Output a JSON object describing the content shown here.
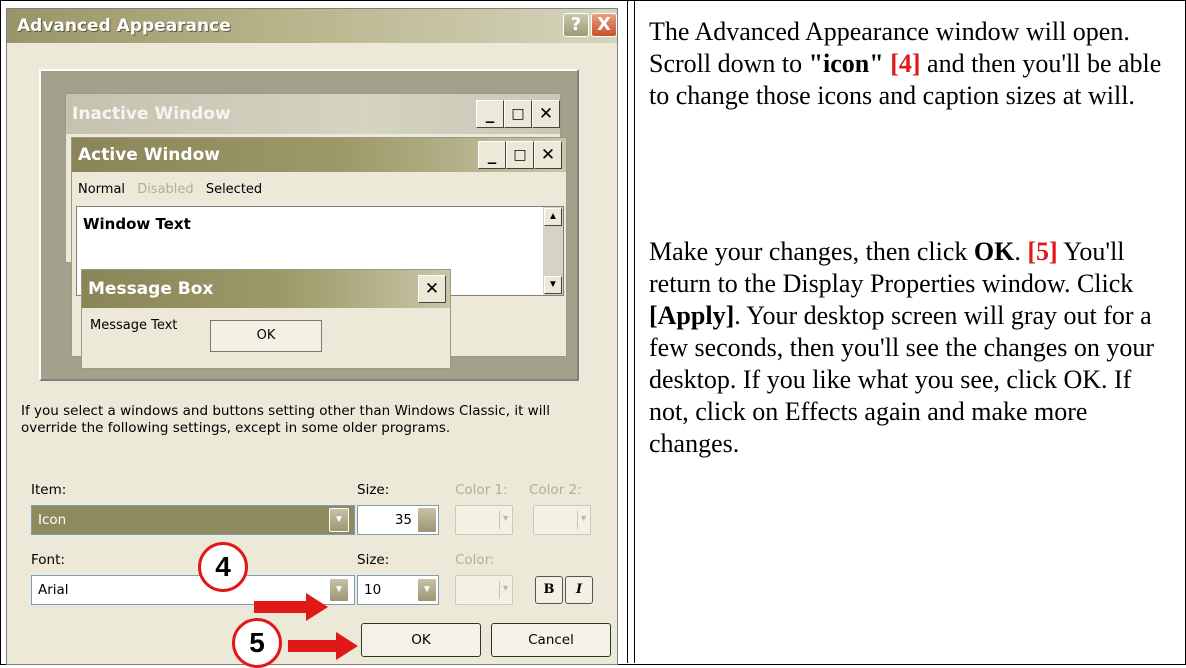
{
  "dialog": {
    "title": "Advanced Appearance",
    "help_icon": "?",
    "close_icon": "X",
    "preview": {
      "inactive_title": "Inactive Window",
      "active_title": "Active Window",
      "menu_normal": "Normal",
      "menu_disabled": "Disabled",
      "menu_selected": "Selected",
      "window_text": "Window Text",
      "messagebox_title": "Message Box",
      "message_text": "Message Text",
      "message_ok": "OK",
      "min_glyph": "_",
      "max_glyph": "□",
      "close_glyph": "✕"
    },
    "note": "If you select a windows and buttons setting other than Windows Classic, it will override the following settings, except in some older programs.",
    "item_label": "Item:",
    "item_value": "Icon",
    "size_label": "Size:",
    "size_value": "35",
    "color1_label": "Color 1:",
    "color2_label": "Color 2:",
    "font_label": "Font:",
    "font_value": "Arial",
    "font_size_label": "Size:",
    "font_size_value": "10",
    "font_color_label": "Color:",
    "bold_label": "B",
    "italic_label": "I",
    "ok_label": "OK",
    "cancel_label": "Cancel"
  },
  "callouts": {
    "step4": "4",
    "step5": "5"
  },
  "instructions": {
    "p1_a": "The Advanced Appearance window will open. Scroll down to ",
    "p1_icon": "\"icon\"",
    "p1_ref": "[4]",
    "p1_b": " and then you'll be able to change those icons and caption sizes at will.",
    "p2_a": "Make your changes, then click ",
    "p2_ok": "OK",
    "p2_dot": ". ",
    "p2_ref": "[5]",
    "p2_b": " You'll return to the Display Properties window. Click ",
    "p2_apply": "[Apply]",
    "p2_c": ". Your desktop screen will gray out for a few seconds, then you'll see the changes on your desktop. If you like what you see, click OK. If not, click on Effects again and make more changes."
  }
}
